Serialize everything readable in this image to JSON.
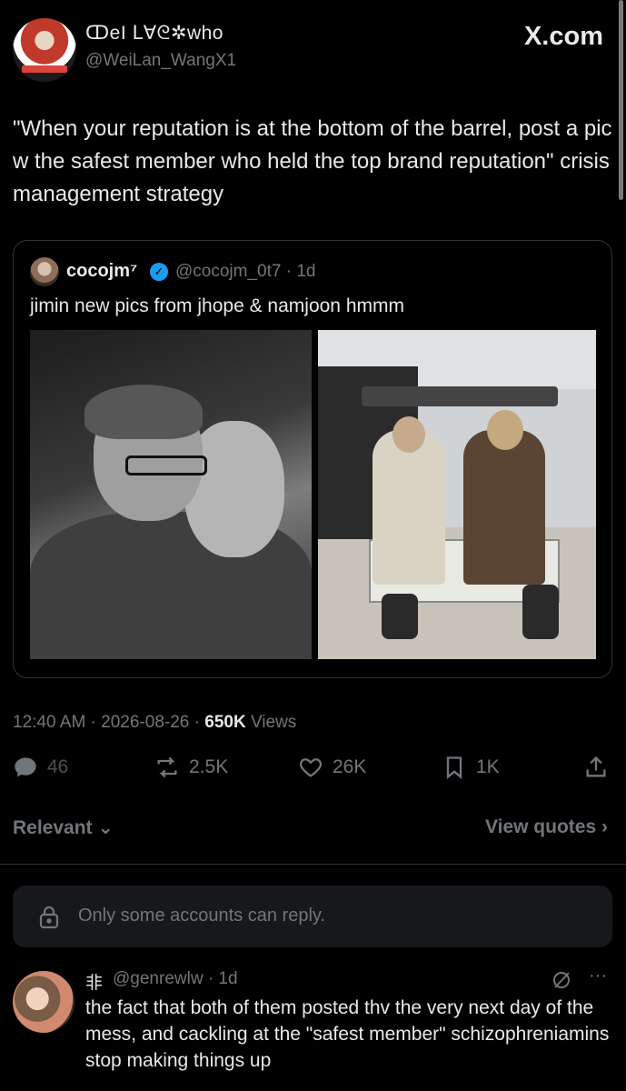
{
  "post": {
    "display_name": "ↀeI ᒪ∀ᘓ✲who",
    "handle": "@WeiLan_WangX1",
    "site_label": "X.com",
    "text": "\"When your reputation is at the bottom of the barrel, post a pic w the safest member who held the top brand reputation\" crisis management strategy"
  },
  "quote": {
    "name": "cocojm⁷",
    "handle": "@cocojm_0t7 · 1d",
    "text": "jimin new pics from jhope & namjoon hmmm"
  },
  "meta": {
    "time_date": "12:40 AM · 2026-08-26 · ",
    "views_count": "650K",
    "views_label": " Views"
  },
  "actions": {
    "replies": "46",
    "reposts": "2.5K",
    "likes": "26K",
    "bookmarks": "1K"
  },
  "sort": {
    "label": "Relevant",
    "view_quotes": "View quotes"
  },
  "reply_restriction": "Only some accounts can reply.",
  "reply": {
    "name": "非",
    "handle": "@genrewlw · 1d",
    "text": "the fact that both of them posted thv the very next day of the mess, and cackling at the \"safest member\" schizophreniamins stop making things up"
  },
  "colors": {
    "background": "#000000",
    "text": "#e7e9ea",
    "muted": "#71767b",
    "verified": "#1d9bf0"
  },
  "icons": [
    "reply-icon",
    "repost-icon",
    "like-icon",
    "bookmark-icon",
    "share-icon",
    "lock-icon",
    "grok-icon",
    "more-icon",
    "verified-icon",
    "chevron-down-icon",
    "chevron-right-icon"
  ]
}
